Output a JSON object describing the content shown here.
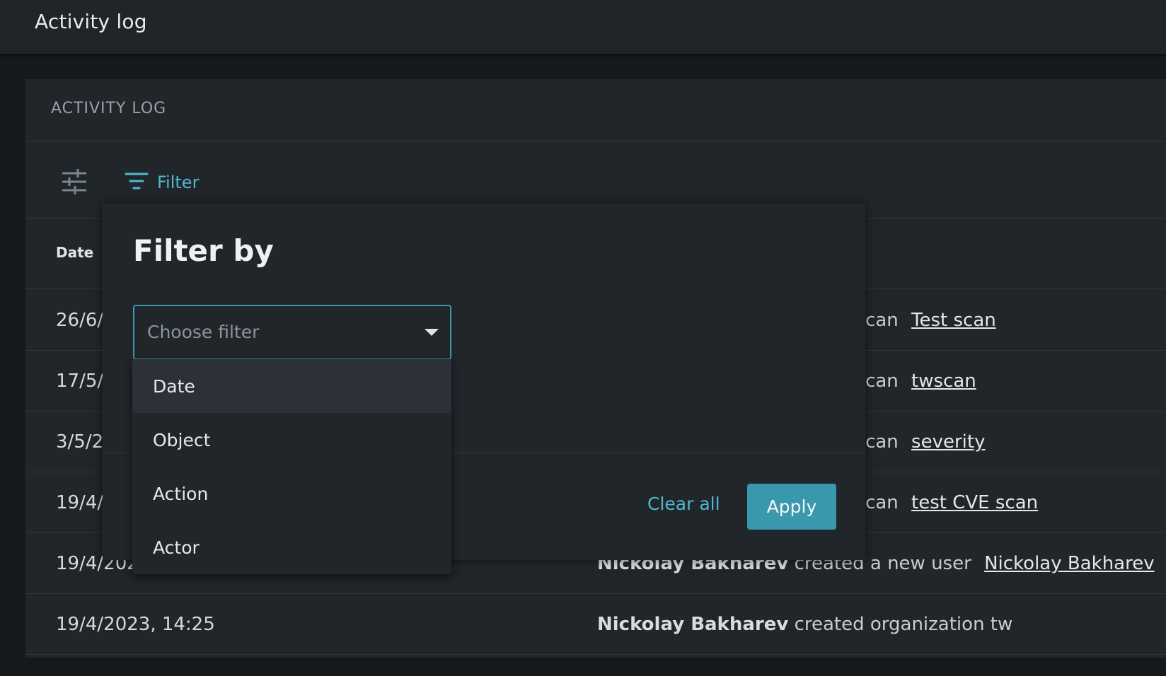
{
  "header": {
    "title": "Activity log"
  },
  "card": {
    "caption": "ACTIVITY LOG",
    "toolbar": {
      "settings_icon": "sliders-icon",
      "filter_icon": "filter-icon",
      "filter_label": "Filter"
    },
    "columns": {
      "date": "Date"
    },
    "rows": [
      {
        "date": "26/6/",
        "description": "ew scan",
        "link": "Test scan"
      },
      {
        "date": "17/5/2",
        "description": "ew scan",
        "link": "twscan"
      },
      {
        "date": "3/5/2",
        "description": "ew scan",
        "link": "severity"
      },
      {
        "date": "19/4/",
        "description": "ew scan",
        "link": "test CVE scan"
      },
      {
        "date": "19/4/202",
        "actor": "Nickolay Bakharev",
        "description": "created a new user",
        "link": "Nickolay Bakharev"
      },
      {
        "date": "19/4/2023, 14:25",
        "actor": "Nickolay Bakharev",
        "description": "created organization tw",
        "link": ""
      }
    ]
  },
  "filter_panel": {
    "heading": "Filter by",
    "select": {
      "placeholder": "Choose filter"
    },
    "options": [
      "Date",
      "Object",
      "Action",
      "Actor"
    ],
    "selected_index": 0,
    "clear_label": "Clear all",
    "apply_label": "Apply"
  },
  "colors": {
    "accent": "#4fb8cf",
    "apply_button": "#3a98ad",
    "background": "#15191c",
    "surface": "#21262b"
  }
}
